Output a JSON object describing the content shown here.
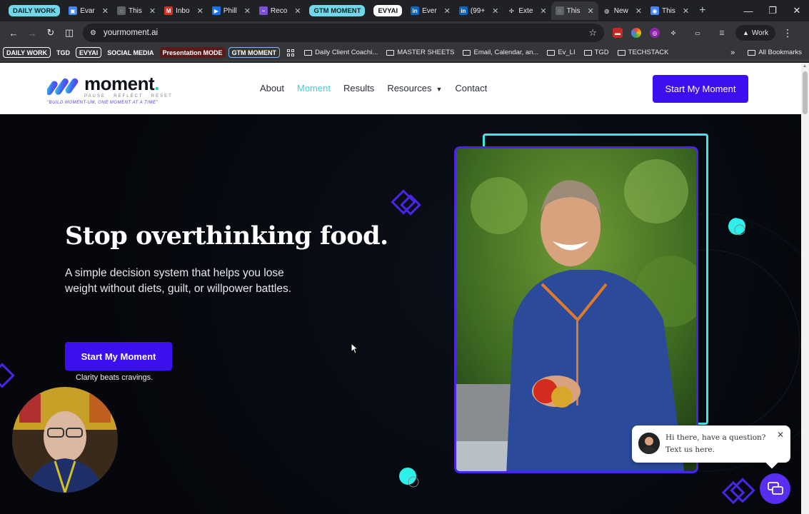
{
  "tabs": [
    {
      "chip": "DAILY WORK",
      "style": "cyan"
    },
    {
      "title": "Evar",
      "favicon_color": "#4285f4",
      "favicon_glyph": "▣"
    },
    {
      "title": "This",
      "favicon_color": "#5f6368",
      "favicon_glyph": "◌"
    },
    {
      "title": "Inbo",
      "favicon_color": "#d93025",
      "favicon_glyph": "M"
    },
    {
      "title": "Phill",
      "favicon_color": "#1a73e8",
      "favicon_glyph": "▶"
    },
    {
      "title": "Reco",
      "favicon_color": "#7b4fd6",
      "favicon_glyph": "~"
    },
    {
      "chip": "GTM MOMENT",
      "style": "cyan"
    },
    {
      "chip": "EVYAI",
      "style": "white"
    },
    {
      "title": "Ever",
      "favicon_color": "#0a66c2",
      "favicon_glyph": "in"
    },
    {
      "title": "(99+",
      "favicon_color": "#0a66c2",
      "favicon_glyph": "in"
    },
    {
      "title": "Exte",
      "favicon_color": "#e8eaed",
      "favicon_glyph": "✣"
    },
    {
      "title": "This",
      "favicon_color": "#5f6368",
      "favicon_glyph": "◌",
      "active": true
    },
    {
      "title": "New",
      "favicon_color": "#e8eaed",
      "favicon_glyph": "◍"
    },
    {
      "title": "This",
      "favicon_color": "#4285f4",
      "favicon_glyph": "◉"
    }
  ],
  "toolbar": {
    "url": "yourmoment.ai",
    "profile": "Work"
  },
  "bookmarks": {
    "chips": [
      {
        "label": "DAILY WORK",
        "style": "outline"
      },
      {
        "label": "TGD",
        "style": "plain"
      },
      {
        "label": "EVYAI",
        "style": "outline"
      },
      {
        "label": "SOCIAL MEDIA",
        "style": "plain"
      },
      {
        "label": "Presentation MODE",
        "style": "red"
      },
      {
        "label": "GTM MOMENT",
        "style": "blue"
      }
    ],
    "folders": [
      "Daily Client Coachi...",
      "MASTER SHEETS",
      "Email, Calendar, an...",
      "Ev_LI",
      "TGD",
      "TECHSTACK"
    ],
    "all_label": "All Bookmarks"
  },
  "site": {
    "logo_word": "moment",
    "logo_tag1": "PAUSE · REFLECT · RESET",
    "logo_tag2": "\"BUILD MOMENT-UM, ONE MOMENT AT A TIME\"",
    "nav": [
      "About",
      "Moment",
      "Results",
      "Resources",
      "Contact"
    ],
    "nav_active_index": 1,
    "header_cta": "Start My Moment",
    "hero_title": "Stop overthinking food.",
    "hero_sub": "A simple decision system that helps you lose weight without diets, guilt, or willpower battles.",
    "hero_cta": "Start My Moment",
    "hero_caption": "Clarity beats cravings.",
    "chat_text": "Hi there, have a question? Text us here."
  },
  "colors": {
    "accent_purple": "#3d0ff0",
    "accent_cyan": "#3ee8e4",
    "hero_bg": "#05070c"
  }
}
